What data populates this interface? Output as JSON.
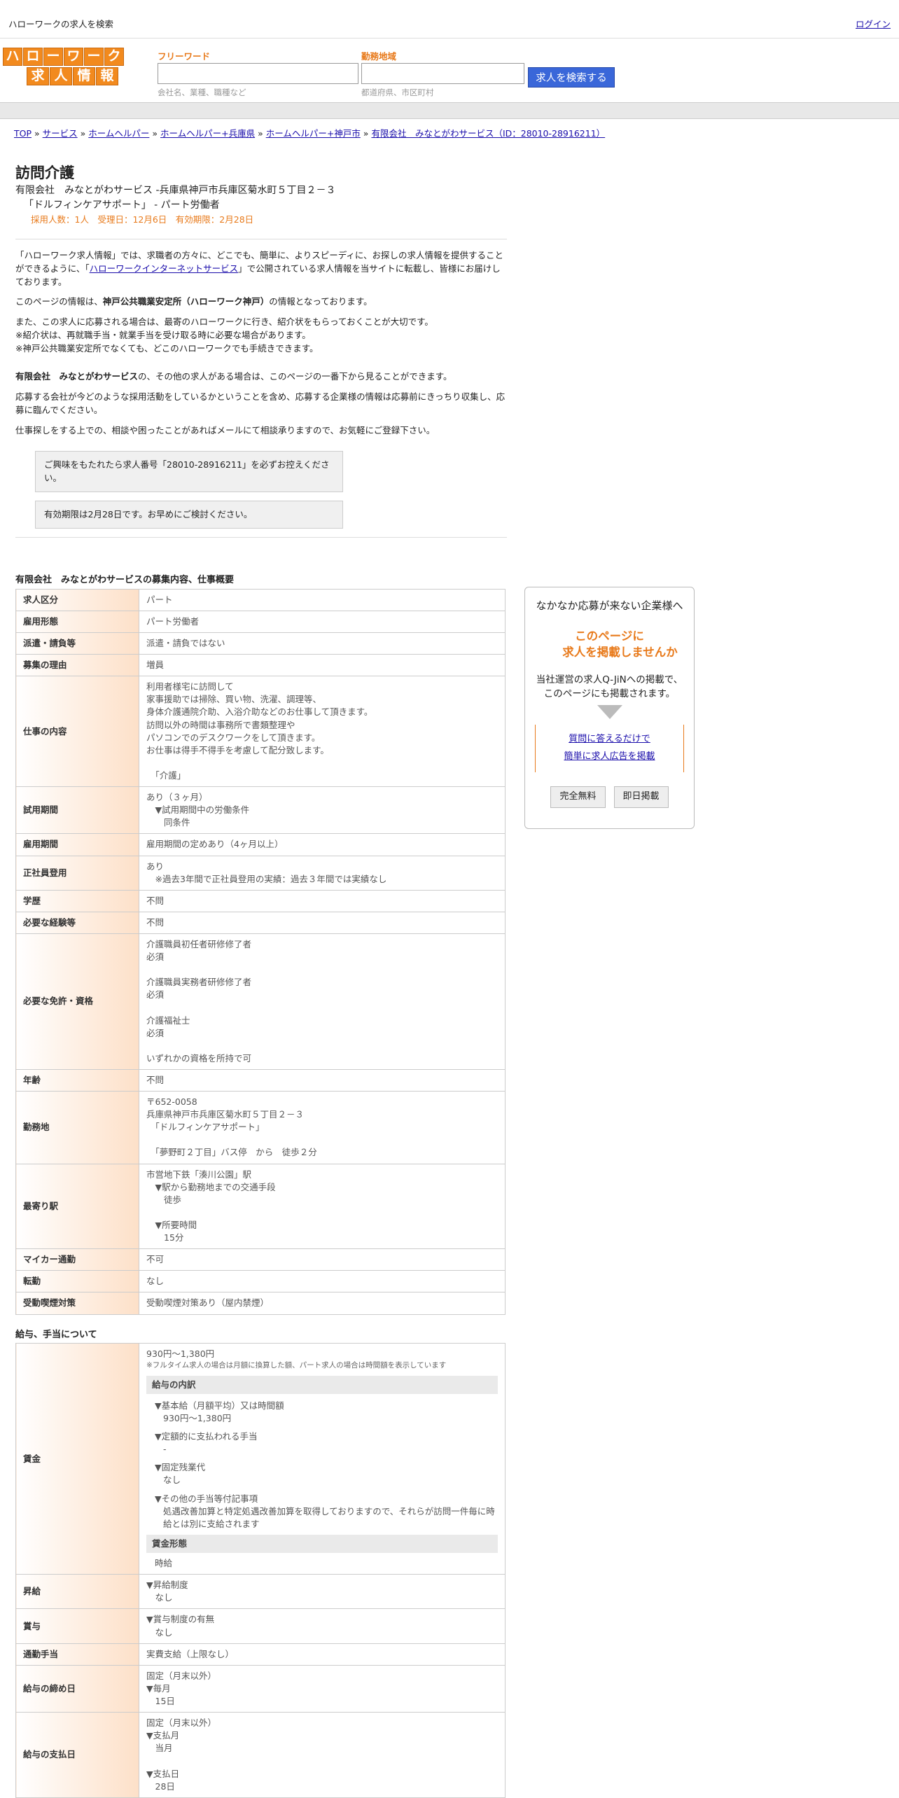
{
  "topbar": {
    "site": "ハローワークの求人を検索",
    "login": "ログイン"
  },
  "logo": {
    "row1": [
      "ハ",
      "ロ",
      "ー",
      "ワ",
      "ー",
      "ク"
    ],
    "row2": [
      "求",
      "人",
      "情",
      "報"
    ]
  },
  "search": {
    "free_label": "フリーワード",
    "free_placeholder": "会社名、業種、職種など",
    "area_label": "勤務地域",
    "area_placeholder": "都道府県、市区町村",
    "button": "求人を検索する"
  },
  "breadcrumb": [
    "TOP",
    "サービス",
    "ホームヘルパー",
    "ホームヘルパー+兵庫県",
    "ホームヘルパー+神戸市",
    "有限会社　みなとがわサービス（ID：28010-28916211）"
  ],
  "job": {
    "title": "訪問介護",
    "company": "有限会社　みなとがわサービス -兵庫県神戸市兵庫区菊水町５丁目２－３",
    "sub": "「ドルフィンケアサポート」 - パート労働者",
    "meta": "採用人数：1人　受理日：12月6日　有効期限：2月28日"
  },
  "intro": {
    "p1a": "「ハローワーク求人情報」では、求職者の方々に、どこでも、簡単に、よりスピーディに、お探しの求人情報を提供することができるように、「",
    "p1link": "ハローワークインターネットサービス",
    "p1b": "」で公開されている求人情報を当サイトに転載し、皆様にお届けしております。",
    "p2a": "このページの情報は、",
    "p2b": "神戸公共職業安定所（ハローワーク神戸）",
    "p2c": "の情報となっております。",
    "p3": [
      "また、この求人に応募される場合は、最寄のハローワークに行き、紹介状をもらっておくことが大切です。",
      "※紹介状は、再就職手当・就業手当を受け取る時に必要な場合があります。",
      "※神戸公共職業安定所でなくても、どこのハローワークでも手続きできます。"
    ],
    "p4a": "有限会社　みなとがわサービス",
    "p4b": "の、その他の求人がある場合は、このページの一番下から見ることができます。",
    "p5": "応募する会社が今どのような採用活動をしているかということを含め、応募する企業様の情報は応募前にきっちり収集し、応募に臨んでください。",
    "p6": "仕事探しをする上での、相談や困ったことがあればメールにて相談承りますので、お気軽にご登録下さい。"
  },
  "notes": [
    "ご興味をもたれたら求人番号「28010-28916211」を必ずお控えください。",
    "有効期限は2月28日です。お早めにご検討ください。"
  ],
  "section1": {
    "title": "有限会社　みなとがわサービスの募集内容、仕事概要",
    "rows": [
      {
        "k": "求人区分",
        "v": [
          "パート"
        ]
      },
      {
        "k": "雇用形態",
        "v": [
          "パート労働者"
        ]
      },
      {
        "k": "派遣・請負等",
        "v": [
          "派遣・請負ではない"
        ]
      },
      {
        "k": "募集の理由",
        "v": [
          "増員"
        ]
      },
      {
        "k": "仕事の内容",
        "v": [
          "利用者様宅に訪問して",
          "家事援助では掃除、買い物、洗濯、調理等、",
          "身体介護通院介助、入浴介助などのお仕事して頂きます。",
          "訪問以外の時間は事務所で書類整理や",
          "パソコンでのデスクワークをして頂きます。",
          "お仕事は得手不得手を考慮して配分致します。",
          "",
          "　「介護」"
        ]
      },
      {
        "k": "試用期間",
        "v": [
          "あり（３ヶ月）",
          "　▼試用期間中の労働条件",
          "　　同条件"
        ]
      },
      {
        "k": "雇用期間",
        "v": [
          "雇用期間の定めあり（4ヶ月以上）"
        ]
      },
      {
        "k": "正社員登用",
        "v": [
          "あり",
          "　※過去3年間で正社員登用の実績：過去３年間では実績なし"
        ]
      },
      {
        "k": "学歴",
        "v": [
          "不問"
        ]
      },
      {
        "k": "必要な経験等",
        "v": [
          "不問"
        ]
      },
      {
        "k": "必要な免許・資格",
        "v": [
          "介護職員初任者研修修了者",
          "必須",
          "",
          "介護職員実務者研修修了者",
          "必須",
          "",
          "介護福祉士",
          "必須",
          "",
          "いずれかの資格を所持で可"
        ]
      },
      {
        "k": "年齢",
        "v": [
          "不問"
        ]
      },
      {
        "k": "勤務地",
        "v": [
          "〒652-0058",
          "兵庫県神戸市兵庫区菊水町５丁目２－３",
          "　「ドルフィンケアサポート」",
          "",
          "　「夢野町２丁目」バス停　から　徒歩２分"
        ]
      },
      {
        "k": "最寄り駅",
        "v": [
          "市営地下鉄「湊川公園」駅",
          "　▼駅から勤務地までの交通手段",
          "　　徒歩",
          "",
          "　▼所要時間",
          "　　15分"
        ]
      },
      {
        "k": "マイカー通勤",
        "v": [
          "不可"
        ]
      },
      {
        "k": "転勤",
        "v": [
          "なし"
        ]
      },
      {
        "k": "受動喫煙対策",
        "v": [
          "受動喫煙対策あり（屋内禁煙）"
        ]
      }
    ]
  },
  "section2": {
    "title": "給与、手当について",
    "wage": {
      "k": "賃金",
      "amount": "930円〜1,380円",
      "note": "※フルタイム求人の場合は月額に換算した額、パート求人の場合は時間額を表示しています",
      "breakdown_title": "給与の内訳",
      "items": [
        {
          "h": "▼基本給（月額平均）又は時間額",
          "v": "930円〜1,380円"
        },
        {
          "h": "▼定額的に支払われる手当",
          "v": "-"
        },
        {
          "h": "▼固定残業代",
          "v": "なし"
        },
        {
          "h": "▼その他の手当等付記事項",
          "v": "処遇改善加算と特定処遇改善加算を取得しておりますので、それらが訪問一件毎に時給とは別に支給されます"
        }
      ],
      "form_title": "賃金形態",
      "form": "時給"
    },
    "rows": [
      {
        "k": "昇給",
        "v": [
          "▼昇給制度",
          "　なし"
        ]
      },
      {
        "k": "賞与",
        "v": [
          "▼賞与制度の有無",
          "　なし"
        ]
      },
      {
        "k": "通勤手当",
        "v": [
          "実費支給（上限なし）"
        ]
      },
      {
        "k": "給与の締め日",
        "v": [
          "固定（月末以外）",
          "▼毎月",
          "　15日"
        ]
      },
      {
        "k": "給与の支払日",
        "v": [
          "固定（月末以外）",
          "▼支払月",
          "　当月",
          "",
          "▼支払日",
          "　28日"
        ]
      }
    ]
  },
  "ad": {
    "heading": "なかなか応募が来ない企業様へ",
    "catch1": "このページに",
    "catch2": "求人を掲載しませんか",
    "desc1": "当社運営の求人Q-JiNへの掲載で、",
    "desc2": "このページにも掲載されます。",
    "link1": "質問に答えるだけで",
    "link2": "簡単に求人広告を掲載",
    "btn1": "完全無料",
    "btn2": "即日掲載"
  }
}
